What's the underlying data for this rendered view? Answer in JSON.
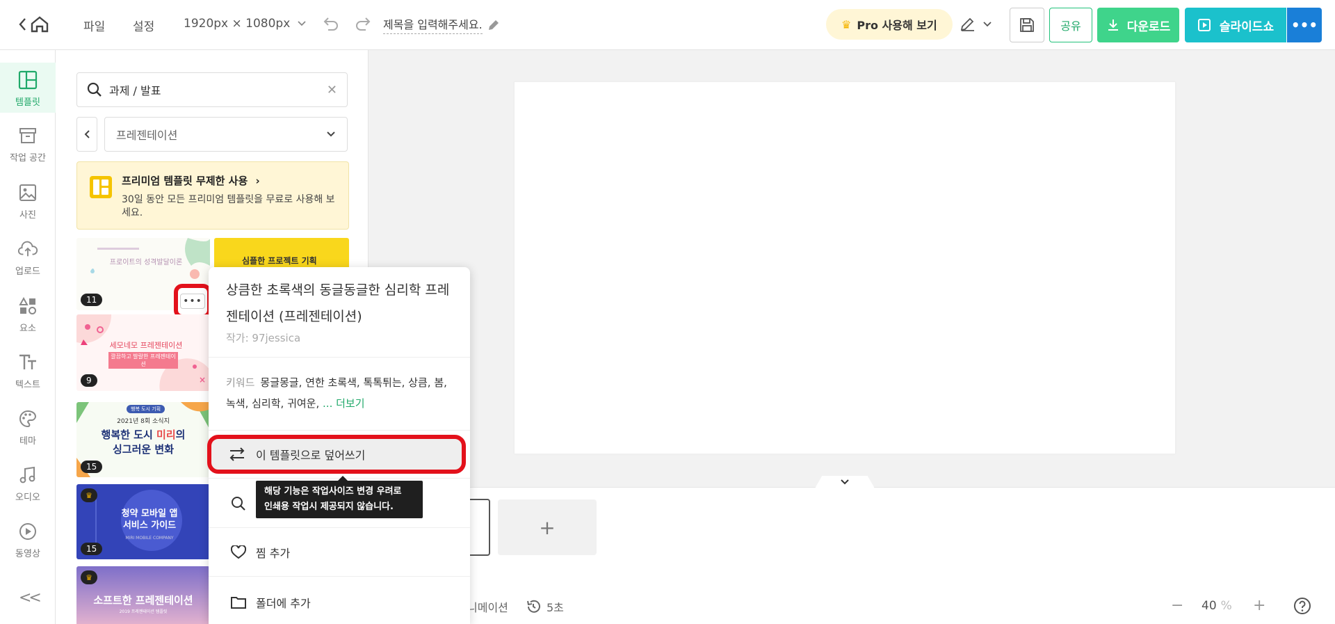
{
  "header": {
    "menu_file": "파일",
    "menu_settings": "설정",
    "size_label": "1920px × 1080px",
    "title_placeholder": "제목을 입력해주세요.",
    "pro_label": "Pro 사용해 보기",
    "share_label": "공유",
    "download_label": "다운로드",
    "slideshow_label": "슬라이드쇼"
  },
  "rail": {
    "items": [
      {
        "label": "템플릿"
      },
      {
        "label": "작업 공간"
      },
      {
        "label": "사진"
      },
      {
        "label": "업로드"
      },
      {
        "label": "요소"
      },
      {
        "label": "텍스트"
      },
      {
        "label": "테마"
      },
      {
        "label": "오디오"
      },
      {
        "label": "동영상"
      }
    ],
    "collapse_label": "<<"
  },
  "panel": {
    "search_value": "과제 / 발표",
    "category": "프레젠테이션",
    "promo_title": "프리미엄 템플릿 무제한 사용",
    "promo_desc": "30일 동안 모든 프리미엄 템플릿을 무료로 사용해 보세요.",
    "thumbs": [
      {
        "count": "11",
        "title": "프로이트의 성격발달이론"
      },
      {
        "title": "심플한 프로젝트 기획"
      },
      {
        "count": "9",
        "title": "세모네모 프레젠테이션",
        "subtitle": "깔끔하고 발랄한 프레젠테이션"
      },
      {
        "count": "15",
        "title_line1": "행복한 도시",
        "title_highlight": "미리",
        "title_line1_end": "의",
        "title_line2": "싱그러운 변화",
        "small": "2021년 8회 소식지",
        "tag": "행복 도시 기획"
      },
      {
        "count": "15",
        "title_line1": "청약 모바일 앱",
        "title_line2": "서비스 가이드",
        "small": "MIRI MOBILE COMPANY"
      },
      {
        "title": "소프트한 프레젠테이션",
        "subtitle": "2019 프레젠테이션 템플릿"
      }
    ]
  },
  "popup": {
    "title": "상큼한 초록색의 동글동글한 심리학 프레젠테이션 (프레젠테이션)",
    "author": "작가: 97jessica",
    "keyword_label": "키워드",
    "keywords": "몽글몽글,  연한 초록색,  톡톡튀는,  상큼,  봄,  녹색,  심리학,  귀여운,",
    "more_label": "... 더보기",
    "overwrite_label": "이 템플릿으로 덮어쓰기",
    "tooltip_line1": "해당 기능은 작업사이즈 변경 우려로",
    "tooltip_line2": "인쇄용 작업시 제공되지 않습니다.",
    "favorite_label": "찜 추가",
    "folder_label": "폴더에 추가"
  },
  "bottom": {
    "animation_label": "니메이션",
    "duration_label": "5초",
    "zoom_value": "40",
    "zoom_unit": "%"
  },
  "colors": {
    "accent_green": "#21a96a",
    "download_green": "#3fd48b",
    "slideshow_teal": "#1bc1cc",
    "more_blue": "#1a7fd8",
    "highlight_red": "#e3111b"
  }
}
